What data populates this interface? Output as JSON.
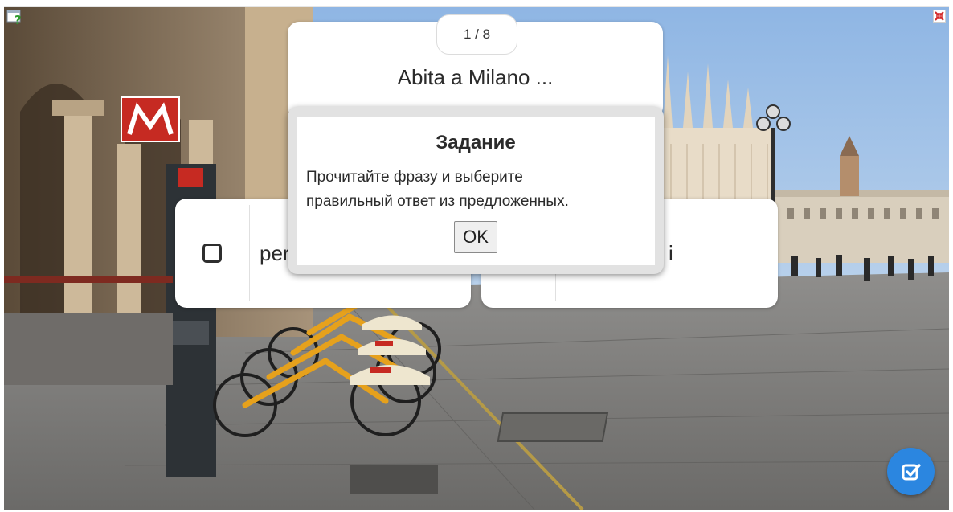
{
  "counter": "1 / 8",
  "question": "Abita a Milano ...",
  "answers": [
    {
      "text": "per"
    },
    {
      "text": "i"
    }
  ],
  "modal": {
    "title": "Задание",
    "line1": "Прочитайте фразу и выберите",
    "line2": "правильный ответ из предложенных.",
    "ok_label": "OK"
  },
  "icons": {
    "help": "help-icon",
    "fullscreen": "fullscreen-exit-icon",
    "check": "check-square-icon"
  },
  "colors": {
    "accent": "#2b86e0",
    "modal_frame": "#e2e2e2"
  }
}
